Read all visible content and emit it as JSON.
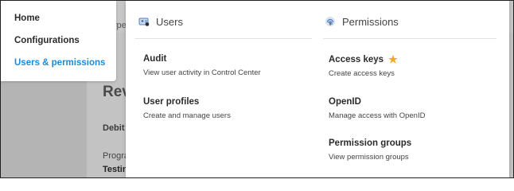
{
  "background": {
    "tab_fragment": "ype",
    "title_fragment": "Rev",
    "debit_fragment": "Debit",
    "program_fragment": "Progra",
    "testing_fragment": "Testin"
  },
  "nav": {
    "items": [
      {
        "label": "Home",
        "active": false
      },
      {
        "label": "Configurations",
        "active": false
      },
      {
        "label": "Users & permissions",
        "active": true
      }
    ],
    "active_color": "#1e8ad6"
  },
  "menu": {
    "users": {
      "heading": "Users",
      "icon": "users-icon",
      "entries": [
        {
          "title": "Audit",
          "description": "View user activity in Control Center"
        },
        {
          "title": "User profiles",
          "description": "Create and manage users"
        }
      ]
    },
    "permissions": {
      "heading": "Permissions",
      "icon": "fingerprint-icon",
      "entries": [
        {
          "title": "Access keys",
          "description": "Create access keys",
          "starred": true
        },
        {
          "title": "OpenID",
          "description": "Manage access with OpenID"
        },
        {
          "title": "Permission groups",
          "description": "View permission groups"
        }
      ]
    }
  },
  "colors": {
    "star": "#f5a623",
    "icon_blue": "#4f7fbf"
  }
}
